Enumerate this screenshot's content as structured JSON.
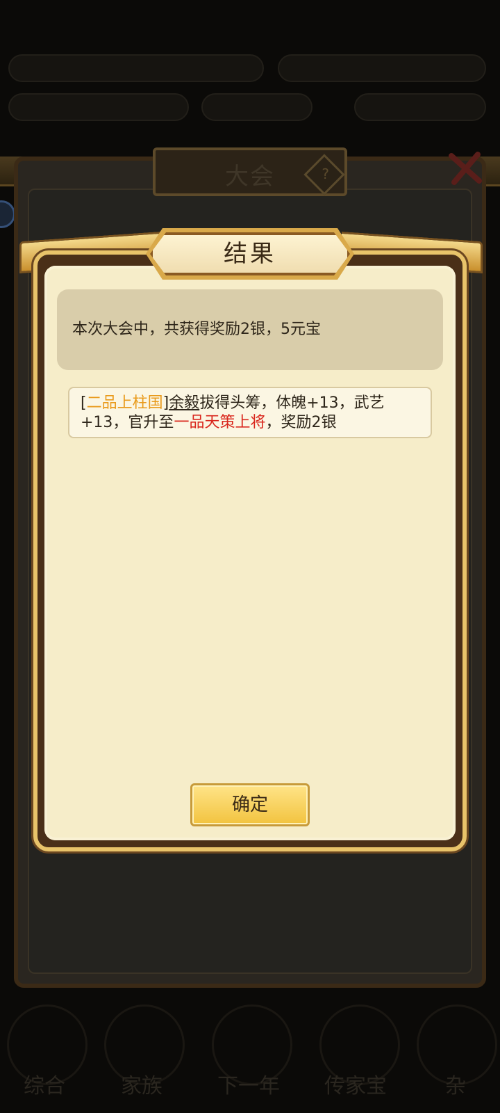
{
  "background": {
    "top_bar": [
      "",
      "",
      "",
      ""
    ],
    "outer_dialog_title": "大会",
    "outer_help_icon": "?",
    "nav": [
      "综合",
      "家族",
      "下一年",
      "传家宝",
      "杂"
    ]
  },
  "dialog": {
    "title": "结果",
    "summary": "本次大会中，共获得奖励2银，5元宝",
    "detail": {
      "bracket_open": "[",
      "rank_before": "二品上柱国",
      "bracket_close": "]",
      "name": "余毅",
      "text_1": "拔得头筹，体魄+13，武艺+13，官升至",
      "rank_after": "一品天策上将",
      "text_2": "，奖励2银"
    },
    "confirm_label": "确定"
  },
  "colors": {
    "rank_before": "#e99a1b",
    "rank_after": "#d9271d",
    "frame_gold": "#e8c36a",
    "parchment": "#f6edc9"
  }
}
